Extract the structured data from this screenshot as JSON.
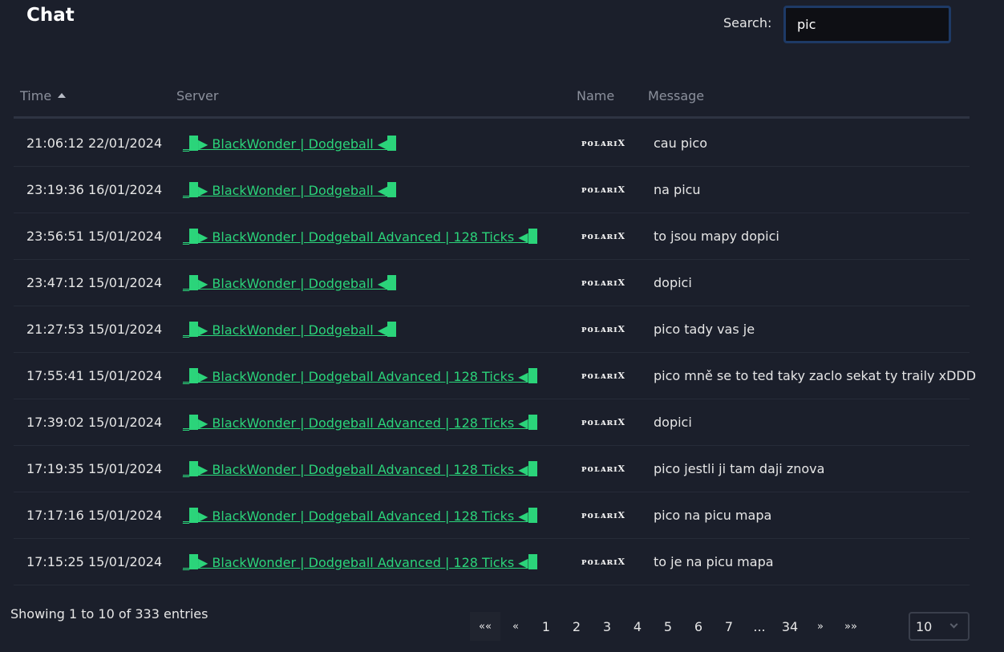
{
  "header": {
    "title": "Chat"
  },
  "search": {
    "label": "Search:",
    "value": "pic"
  },
  "table": {
    "columns": [
      "Time",
      "Server",
      "Name",
      "Message"
    ],
    "rows": [
      {
        "time": "21:06:12 22/01/2024",
        "server": "▶ BlackWonder | Dodgeball ◀",
        "name": "ᴘᴏʟᴀʀɪX",
        "message": "cau pico"
      },
      {
        "time": "23:19:36 16/01/2024",
        "server": "▶ BlackWonder | Dodgeball ◀",
        "name": "ᴘᴏʟᴀʀɪX",
        "message": "na picu"
      },
      {
        "time": "23:56:51 15/01/2024",
        "server": "▶ BlackWonder | Dodgeball Advanced | 128 Ticks ◀",
        "name": "ᴘᴏʟᴀʀɪX",
        "message": "to jsou mapy dopici"
      },
      {
        "time": "23:47:12 15/01/2024",
        "server": "▶ BlackWonder | Dodgeball ◀",
        "name": "ᴘᴏʟᴀʀɪX",
        "message": "dopici"
      },
      {
        "time": "21:27:53 15/01/2024",
        "server": "▶ BlackWonder | Dodgeball ◀",
        "name": "ᴘᴏʟᴀʀɪX",
        "message": "pico tady vas je"
      },
      {
        "time": "17:55:41 15/01/2024",
        "server": "▶ BlackWonder | Dodgeball Advanced | 128 Ticks ◀",
        "name": "ᴘᴏʟᴀʀɪX",
        "message": "pico mně se to ted taky zaclo sekat ty traily xDDD"
      },
      {
        "time": "17:39:02 15/01/2024",
        "server": "▶ BlackWonder | Dodgeball Advanced | 128 Ticks ◀",
        "name": "ᴘᴏʟᴀʀɪX",
        "message": "dopici"
      },
      {
        "time": "17:19:35 15/01/2024",
        "server": "▶ BlackWonder | Dodgeball Advanced | 128 Ticks ◀",
        "name": "ᴘᴏʟᴀʀɪX",
        "message": "pico jestli ji tam daji znova"
      },
      {
        "time": "17:17:16 15/01/2024",
        "server": "▶ BlackWonder | Dodgeball Advanced | 128 Ticks ◀",
        "name": "ᴘᴏʟᴀʀɪX",
        "message": "pico na picu mapa"
      },
      {
        "time": "17:15:25 15/01/2024",
        "server": "▶ BlackWonder | Dodgeball Advanced | 128 Ticks ◀",
        "name": "ᴘᴏʟᴀʀɪX",
        "message": "to je na picu mapa"
      }
    ]
  },
  "footer": {
    "info": "Showing 1 to 10 of 333 entries",
    "pagination": [
      "««",
      "«",
      "1",
      "2",
      "3",
      "4",
      "5",
      "6",
      "7",
      "...",
      "34",
      "»",
      "»»"
    ],
    "page_length": "10"
  },
  "colors": {
    "background": "#1b1f2b",
    "link": "#2bd47a",
    "search_border": "#1e3a66"
  },
  "icons": {
    "sort": "sort-ascending-icon",
    "dropdown": "chevron-down-icon"
  }
}
